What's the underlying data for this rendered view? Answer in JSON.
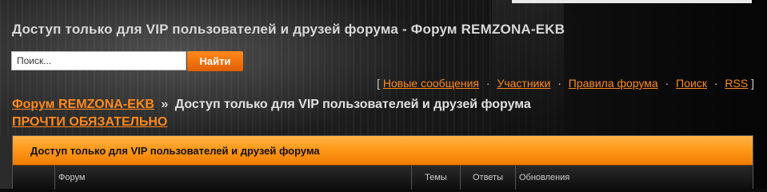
{
  "header": {
    "title": "Доступ только для VIP пользователей и друзей форума - Форум REMZONA-EKB"
  },
  "search": {
    "placeholder": "Поиск...",
    "button_label": "Найти"
  },
  "nav": {
    "open_bracket": "[",
    "close_bracket": "]",
    "separator": "·",
    "links": [
      "Новые сообщения",
      "Участники",
      "Правила форума",
      "Поиск",
      "RSS"
    ]
  },
  "breadcrumb": {
    "root": "Форум REMZONA-EKB",
    "arrow": "»",
    "current": "Доступ только для VIP пользователей и друзей форума"
  },
  "notice_link": "ПРОЧТИ ОБЯЗАТЕЛЬНО",
  "forum_table": {
    "category": "Доступ только для VIP пользователей и друзей форума",
    "columns": [
      "",
      "Форум",
      "Темы",
      "Ответы",
      "Обновления"
    ]
  },
  "colors": {
    "accent": "#ff8a1c",
    "background": "#0b0b0b",
    "text": "#d8d8d8"
  }
}
